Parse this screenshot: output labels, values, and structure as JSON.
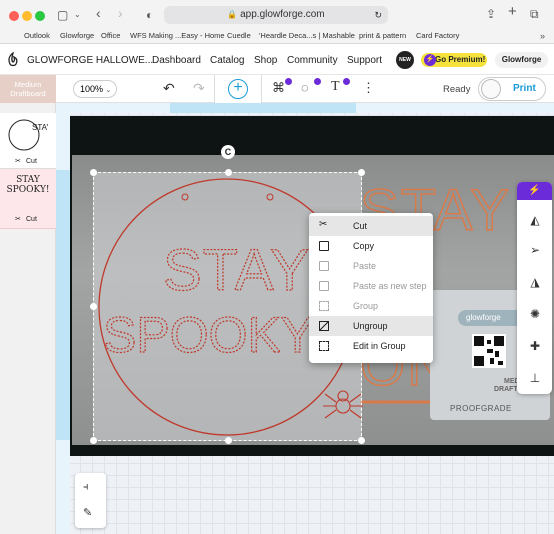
{
  "browser": {
    "url": "app.glowforge.com",
    "bookmarks": [
      "Outlook",
      "Glowforge",
      "Office",
      "WFS Making ...Easy - Home",
      "Cuedle",
      "'Heardle Deca...s | Mashable",
      "print & pattern",
      "Card Factory"
    ]
  },
  "header": {
    "title": "GLOWFORGE HALLOWE...",
    "nav": [
      "Dashboard",
      "Catalog",
      "Shop",
      "Community",
      "Support"
    ],
    "new_badge": "NEW",
    "premium_label": "Go Premium!",
    "account_label": "Glowforge"
  },
  "toolbar": {
    "material_label": "Medium Draftboard",
    "zoom": "100%",
    "status": "Ready",
    "print_label": "Print"
  },
  "sidebar": {
    "items": [
      {
        "thumb": "STAY",
        "op": "Cut"
      },
      {
        "thumb": "STAY SPOOKY!",
        "op": "Cut"
      }
    ]
  },
  "canvas": {
    "design_text_line1": "STAY",
    "design_text_line2": "SPOOKY!",
    "bg_text_line1": "STAY",
    "bg_text_line2": "ONKY",
    "bg_brand": "glowforge",
    "bg_label1": "MEDI",
    "bg_label2": "DRAFTBO",
    "bg_proofgrade": "PROOFGRADE",
    "rotate_handle": "C"
  },
  "context_menu": {
    "items": [
      {
        "label": "Cut",
        "enabled": true,
        "highlight": true
      },
      {
        "label": "Copy",
        "enabled": true,
        "highlight": false
      },
      {
        "label": "Paste",
        "enabled": false,
        "highlight": false
      },
      {
        "label": "Paste as new step",
        "enabled": false,
        "highlight": false
      },
      {
        "label": "Group",
        "enabled": false,
        "highlight": false
      },
      {
        "label": "Ungroup",
        "enabled": true,
        "highlight": true
      },
      {
        "label": "Edit in Group",
        "enabled": true,
        "highlight": false
      }
    ]
  },
  "colors": {
    "accent_blue": "#1a9bd7",
    "premium_yellow": "#f5e23d",
    "purple": "#6c2bd9",
    "design_red": "#c0392b",
    "sidebar_pink": "#fde7ea"
  }
}
